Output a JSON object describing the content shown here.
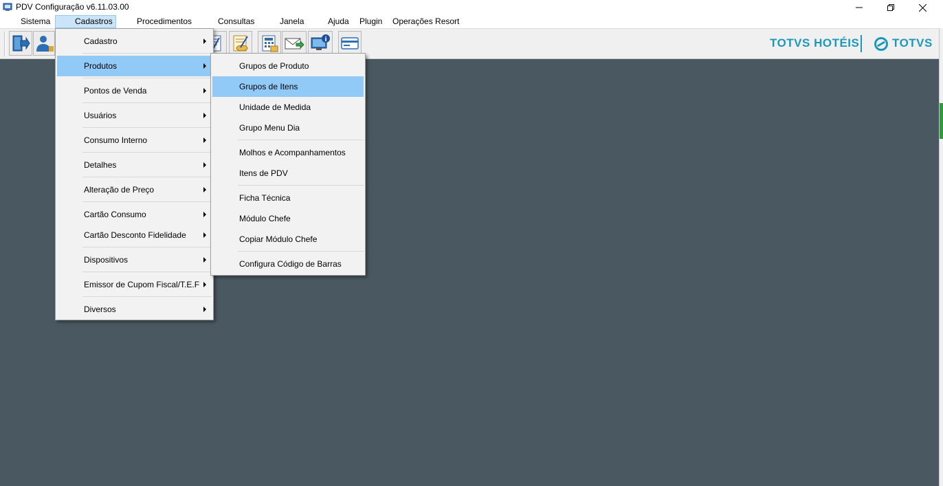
{
  "window": {
    "title": "PDV Configuração v6.11.03.00",
    "controls": {
      "minimize": "—",
      "restore": "❐",
      "close": "✕"
    }
  },
  "menubar": {
    "items": [
      "Sistema",
      "Cadastros",
      "Procedimentos",
      "Consultas",
      "Janela",
      "Ajuda",
      "Plugin",
      "Operações Resort"
    ],
    "active": "Cadastros"
  },
  "toolbar": {
    "icons": [
      "exit-icon",
      "users-icon",
      "document-edit-icon",
      "money-edit-icon",
      "calculator-icon",
      "mail-send-icon",
      "monitor-info-icon",
      "credit-card-icon"
    ]
  },
  "brand": {
    "left": "TOTVS HOTÉIS",
    "right": "TOTVS"
  },
  "cadastros_menu": {
    "items": [
      {
        "label": "Cadastro",
        "submenu": true
      },
      {
        "label": "Produtos",
        "submenu": true,
        "highlighted": true
      },
      {
        "label": "Pontos de Venda",
        "submenu": true
      },
      {
        "label": "Usuários",
        "submenu": true
      },
      {
        "label": "Consumo Interno",
        "submenu": true
      },
      {
        "label": "Detalhes",
        "submenu": true
      },
      {
        "label": "Alteração de Preço",
        "submenu": true
      },
      {
        "label": "Cartão Consumo",
        "submenu": true
      },
      {
        "label": "Cartão Desconto Fidelidade",
        "submenu": true
      },
      {
        "label": "Dispositivos",
        "submenu": true
      },
      {
        "label": "Emissor de Cupom Fiscal/T.E.F",
        "submenu": true
      },
      {
        "label": "Diversos",
        "submenu": true
      }
    ]
  },
  "produtos_menu": {
    "items": [
      {
        "label": "Grupos de Produto"
      },
      {
        "label": "Grupos de Itens",
        "highlighted": true
      },
      {
        "label": "Unidade de Medida"
      },
      {
        "label": "Grupo Menu Dia"
      },
      {
        "label": "Molhos e Acompanhamentos"
      },
      {
        "label": "Itens de PDV"
      },
      {
        "label": "Ficha Técnica"
      },
      {
        "label": "Módulo Chefe"
      },
      {
        "label": "Copiar Módulo Chefe"
      },
      {
        "label": "Configura Código de Barras"
      }
    ]
  },
  "colors": {
    "workspace": "#4a5961",
    "highlight": "#91c9f7",
    "brand": "#1d98b9"
  }
}
